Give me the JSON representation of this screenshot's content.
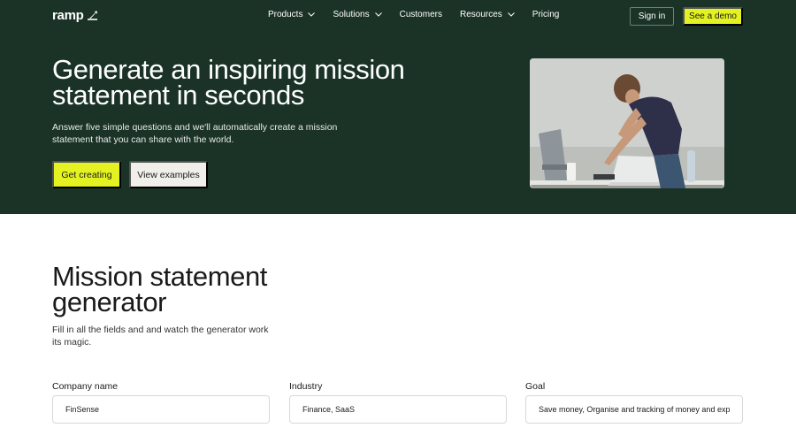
{
  "nav": {
    "logo": "ramp",
    "menu": [
      {
        "label": "Products",
        "dropdown": true
      },
      {
        "label": "Solutions",
        "dropdown": true
      },
      {
        "label": "Customers",
        "dropdown": false
      },
      {
        "label": "Resources",
        "dropdown": true
      },
      {
        "label": "Pricing",
        "dropdown": false
      }
    ],
    "signin": "Sign in",
    "demo": "See a demo"
  },
  "hero": {
    "title": "Generate an inspiring mission statement in seconds",
    "subtitle": "Answer five simple questions and we'll automatically create a mission statement that you can share with the world.",
    "primary_cta": "Get creating",
    "secondary_cta": "View examples"
  },
  "generator": {
    "title": "Mission statement generator",
    "subtitle": "Fill in all the fields and and watch the generator work its magic.",
    "fields": [
      {
        "label": "Company name",
        "value": "FinSense"
      },
      {
        "label": "Industry",
        "value": "Finance, SaaS"
      },
      {
        "label": "Goal",
        "value": "Save money, Organise and tracking of money and expenses"
      }
    ]
  },
  "colors": {
    "hero_bg": "#1a3326",
    "accent": "#e4f221",
    "secondary_button": "#f0efea"
  }
}
